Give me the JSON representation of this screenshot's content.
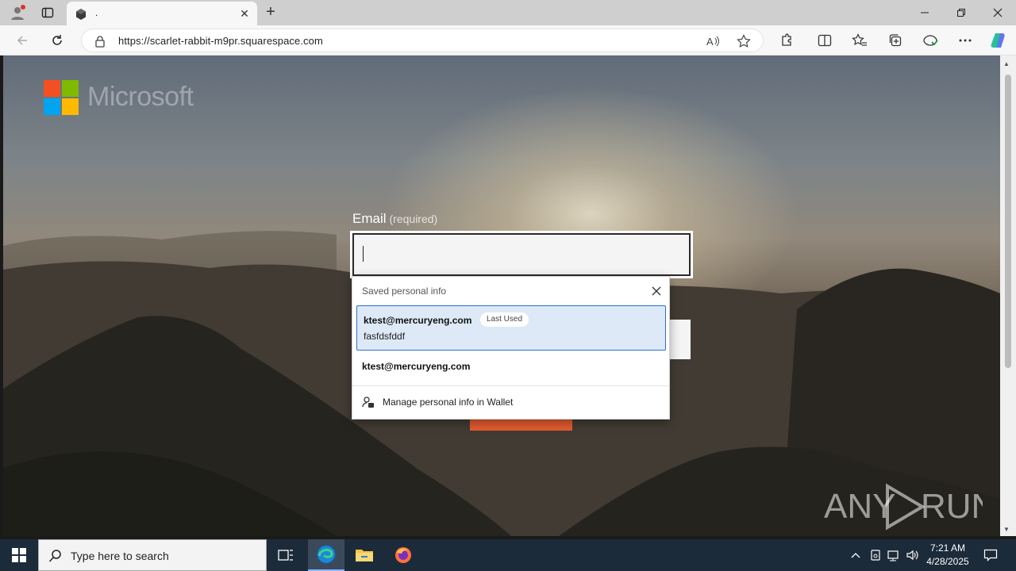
{
  "browser": {
    "tab": {
      "title": "."
    },
    "address": {
      "url": "https://scarlet-rabbit-m9pr.squarespace.com"
    }
  },
  "page": {
    "logo_text": "Microsoft",
    "email": {
      "label": "Email",
      "required": "(required)",
      "value": ""
    },
    "watermark": "ANY RUN"
  },
  "autofill": {
    "header": "Saved personal info",
    "suggestions": [
      {
        "email": "ktest@mercuryeng.com",
        "badge": "Last Used",
        "detail": "fasfdsfddf"
      },
      {
        "email": "ktest@mercuryeng.com"
      }
    ],
    "manage_label": "Manage personal info in Wallet"
  },
  "taskbar": {
    "search_placeholder": "Type here to search",
    "time": "7:21 AM",
    "date": "4/28/2025"
  },
  "colors": {
    "ms_red": "#f25022",
    "ms_green": "#7fba00",
    "ms_blue": "#00a4ef",
    "ms_yellow": "#ffb900",
    "accent_orange": "#e25a2f",
    "selection_blue": "#2c6fc5"
  }
}
